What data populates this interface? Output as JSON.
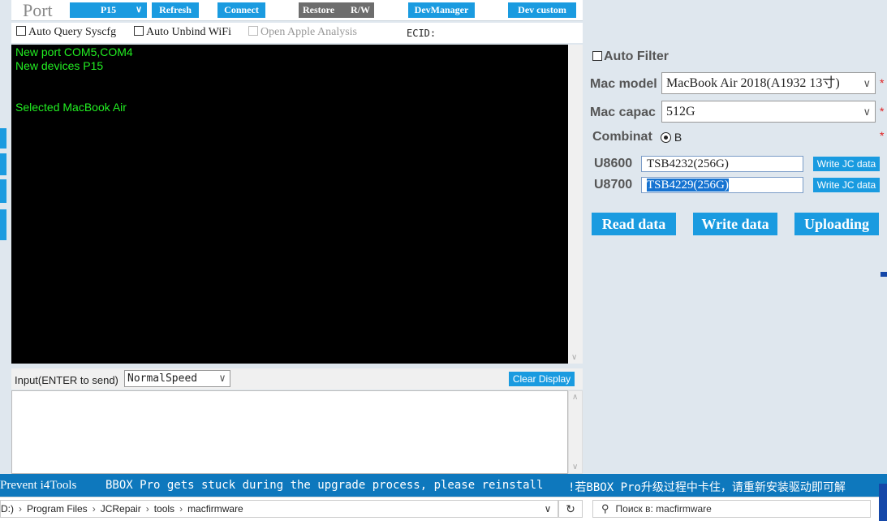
{
  "toolbar": {
    "port_label": "Port",
    "port_select": "P15",
    "refresh": "Refresh",
    "connect": "Connect",
    "restore": "Restore",
    "rw": "R/W",
    "dev_manager": "DevManager",
    "dev_custom": "Dev custom"
  },
  "options": {
    "auto_query": "Auto Query Syscfg",
    "auto_unbind": "Auto Unbind WiFi",
    "open_apple": "Open Apple Analysis",
    "ecid": "ECID:"
  },
  "console": {
    "lines": [
      "New port COM5,COM4",
      "New devices P15",
      "",
      "",
      "Selected MacBook Air"
    ]
  },
  "input_row": {
    "label": "Input(ENTER to send)",
    "speed": "NormalSpeed",
    "clear": "Clear Display"
  },
  "right_panel": {
    "auto_filter": "Auto Filter",
    "mac_model_label": "Mac model",
    "mac_model_value": "MacBook Air 2018(A1932 13寸)",
    "mac_capac_label": "Mac capac",
    "mac_capac_value": "512G",
    "combinat_label": "Combinat",
    "combinat_option": "B",
    "star": "*",
    "u8600_label": "U8600",
    "u8600_value": "TSB4232(256G)",
    "u8700_label": "U8700",
    "u8700_value": "TSB4229(256G)",
    "write_jc": "Write JC data",
    "read_data": "Read data",
    "write_data": "Write data",
    "uploading": "Uploading"
  },
  "marquee": {
    "left": "Prevent i4Tools",
    "middle": "BBOX Pro gets stuck during the upgrade process, please reinstall",
    "right": "!若BBOX Pro升级过程中卡住，请重新安装驱动即可解"
  },
  "explorer": {
    "crumbs": [
      "D:)",
      "Program Files",
      "JCRepair",
      "tools",
      "macfirmware"
    ],
    "search_placeholder": "Поиск в: macfirmware"
  },
  "colors": {
    "accent": "#1a9be0",
    "console_bg": "#000000",
    "console_text": "#22ee22",
    "required_star": "#e02020",
    "marquee_bg": "#0e78bd"
  },
  "icons": [
    "chevron-down-icon",
    "radio-selected-icon",
    "refresh-icon",
    "search-icon"
  ]
}
